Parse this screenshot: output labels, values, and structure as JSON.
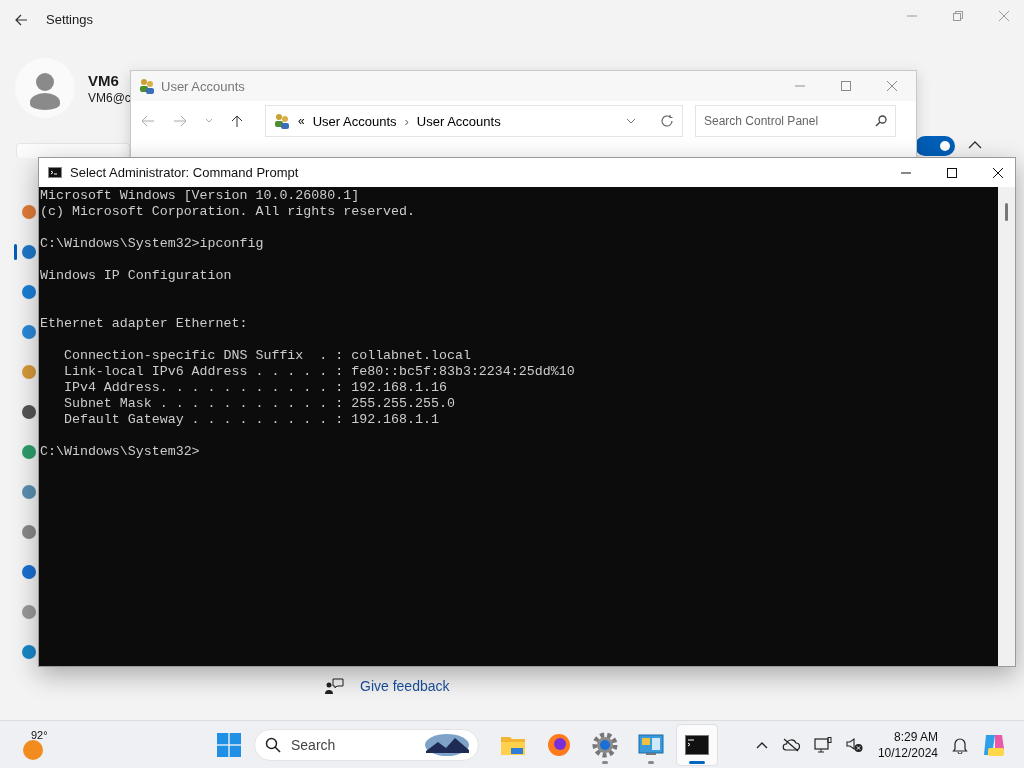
{
  "settings": {
    "title": "Settings",
    "user": {
      "name": "VM6",
      "email": "VM6@c"
    },
    "sidebar_items": [
      {
        "selected": false
      },
      {
        "selected": true
      },
      {
        "selected": false
      },
      {
        "selected": false
      },
      {
        "selected": false
      },
      {
        "selected": false
      },
      {
        "selected": false
      },
      {
        "selected": false
      },
      {
        "selected": false
      },
      {
        "selected": false
      },
      {
        "selected": false
      },
      {
        "selected": false
      }
    ],
    "toggle": {
      "on": true
    },
    "feedback": "Give feedback"
  },
  "user_accounts": {
    "title": "User Accounts",
    "breadcrumb_overflow": "«",
    "breadcrumb_separator": "›",
    "breadcrumb": [
      "User Accounts",
      "User Accounts"
    ],
    "search": {
      "placeholder": "Search Control Panel"
    }
  },
  "command_prompt": {
    "title": "Select Administrator: Command Prompt",
    "blocks": [
      {
        "kind": "output",
        "lines": [
          "Microsoft Windows [Version 10.0.26080.1]",
          "(c) Microsoft Corporation. All rights reserved."
        ]
      },
      {
        "kind": "output",
        "lines": [
          "C:\\Windows\\System32>ipconfig"
        ]
      },
      {
        "kind": "heading",
        "lines": [
          "Windows IP Configuration"
        ]
      },
      {
        "kind": "output",
        "lines": [
          "Ethernet adapter Ethernet:"
        ]
      },
      {
        "kind": "output",
        "lines": [
          "   Connection-specific DNS Suffix  . : collabnet.local",
          "   Link-local IPv6 Address . . . . . : fe80::bc5f:83b3:2234:25dd%10",
          "   IPv4 Address. . . . . . . . . . . : 192.168.1.16",
          "   Subnet Mask . . . . . . . . . . . : 255.255.255.0",
          "   Default Gateway . . . . . . . . . : 192.168.1.1"
        ]
      },
      {
        "kind": "output",
        "lines": [
          "C:\\Windows\\System32>"
        ]
      }
    ]
  },
  "taskbar": {
    "weather": "92°",
    "search": {
      "placeholder": "Search"
    },
    "apps": [
      {
        "kind": "files",
        "running": false,
        "selected": false
      },
      {
        "kind": "browser",
        "running": false,
        "selected": false
      },
      {
        "kind": "settings",
        "running": true,
        "selected": false
      },
      {
        "kind": "control-panel",
        "running": true,
        "selected": false
      },
      {
        "kind": "terminal",
        "running": true,
        "selected": true
      }
    ],
    "time": "8:29 AM",
    "date": "10/12/2024"
  }
}
